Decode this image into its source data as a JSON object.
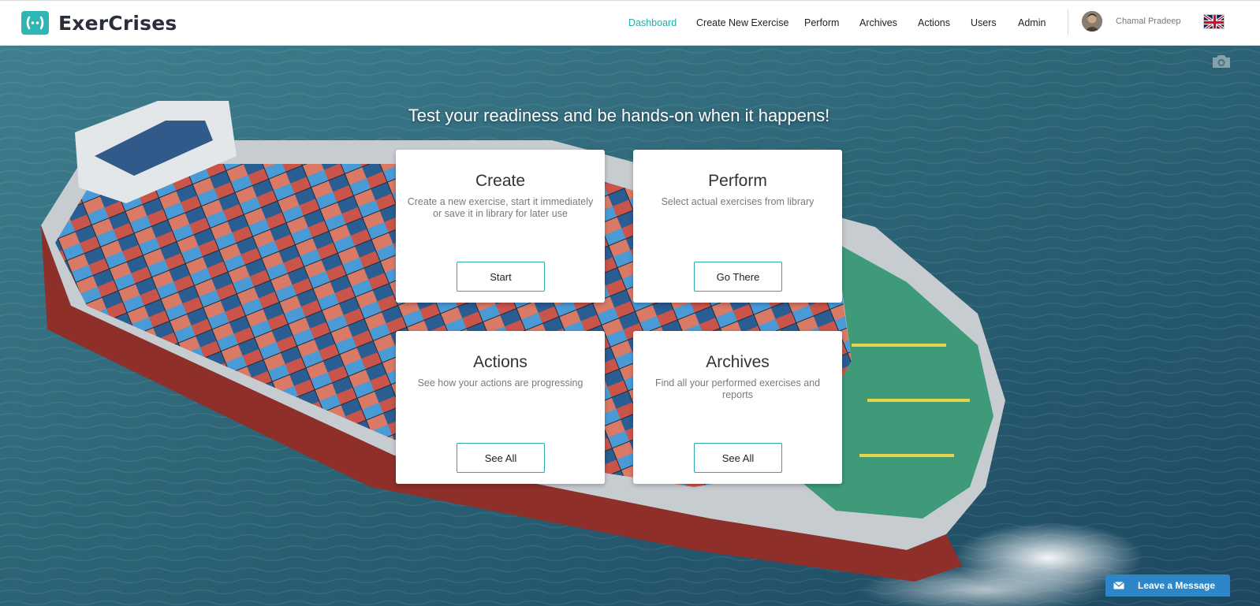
{
  "brand": {
    "name": "ExerCrises",
    "logo_icon": "wave-brackets-icon",
    "accent": "#2fb5b3"
  },
  "nav": {
    "items": [
      {
        "label": "Dashboard",
        "active": true
      },
      {
        "label": "Create New Exercise",
        "active": false
      },
      {
        "label": "Perform",
        "active": false
      },
      {
        "label": "Archives",
        "active": false
      },
      {
        "label": "Actions",
        "active": false
      },
      {
        "label": "Users",
        "active": false
      },
      {
        "label": "Admin",
        "active": false
      }
    ],
    "active_color": "#2aa9a7"
  },
  "user": {
    "name": "Chamal Pradeep",
    "avatar_icon": "user-avatar-icon"
  },
  "language": {
    "flag_icon": "uk-flag-icon"
  },
  "hero": {
    "tagline": "Test your readiness and be hands-on when it happens!",
    "background": "container-ship-aerial-photo",
    "camera_icon": "camera-icon"
  },
  "cards": [
    {
      "title": "Create",
      "description": "Create a new exercise, start it immediately or save it in library for later use",
      "button": "Start"
    },
    {
      "title": "Perform",
      "description": "Select actual exercises from library",
      "button": "Go There"
    },
    {
      "title": "Actions",
      "description": "See how your actions are progressing",
      "button": "See All"
    },
    {
      "title": "Archives",
      "description": "Find all your performed exercises and reports",
      "button": "See All"
    }
  ],
  "chat": {
    "label": "Leave a Message",
    "icon": "mail-icon",
    "color": "#2e86c8"
  }
}
